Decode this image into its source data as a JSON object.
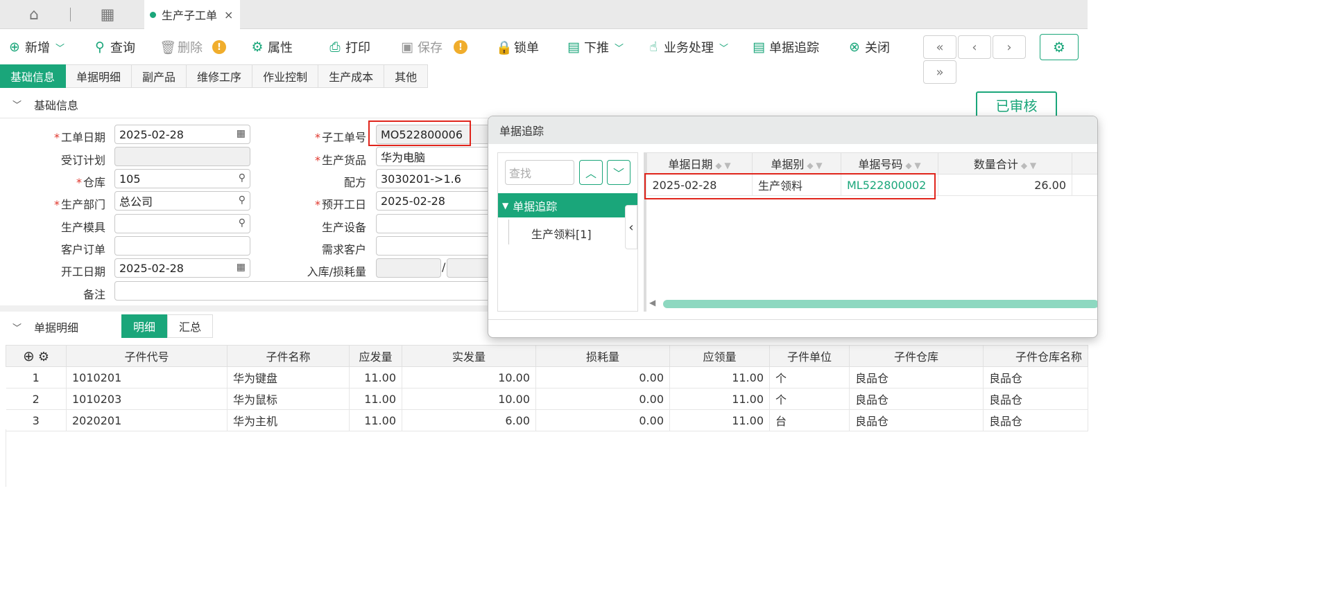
{
  "tabbar": {
    "doc_tab": "生产子工单",
    "close": "×"
  },
  "toolbar": {
    "add": "新增",
    "query": "查询",
    "delete": "删除",
    "properties": "属性",
    "print": "打印",
    "save": "保存",
    "lock": "锁单",
    "push_down": "下推",
    "business": "业务处理",
    "trace": "单据追踪",
    "close": "关闭",
    "warn_mark": "!"
  },
  "nav": {
    "first": "«",
    "prev": "‹",
    "next": "›",
    "last": "»"
  },
  "subtabs": [
    "基础信息",
    "单据明细",
    "副产品",
    "维修工序",
    "作业控制",
    "生产成本",
    "其他"
  ],
  "sections": {
    "basic": "基础信息",
    "detail": "单据明细"
  },
  "status_badge": "已审核",
  "form": {
    "order_date": {
      "label": "工单日期",
      "value": "2025-02-28"
    },
    "sub_order_no": {
      "label": "子工单号",
      "value": "MO522800006"
    },
    "plan": {
      "label": "受订计划",
      "value": ""
    },
    "product": {
      "label": "生产货品",
      "value": "华为电脑"
    },
    "warehouse": {
      "label": "仓库",
      "value": "105"
    },
    "formula": {
      "label": "配方",
      "value": "3030201->1.6"
    },
    "dept": {
      "label": "生产部门",
      "value": "总公司"
    },
    "planned_start": {
      "label": "预开工日",
      "value": "2025-02-28"
    },
    "mold": {
      "label": "生产模具",
      "value": ""
    },
    "equipment": {
      "label": "生产设备",
      "value": ""
    },
    "customer_order": {
      "label": "客户订单",
      "value": ""
    },
    "demand_customer": {
      "label": "需求客户",
      "value": ""
    },
    "start_date": {
      "label": "开工日期",
      "value": "2025-02-28"
    },
    "in_loss": {
      "label": "入库/损耗量",
      "sep": "/"
    },
    "remark": {
      "label": "备注",
      "value": ""
    }
  },
  "detail_tabs": [
    "明细",
    "汇总"
  ],
  "detail_table": {
    "headers": [
      "子件代号",
      "子件名称",
      "应发量",
      "实发量",
      "损耗量",
      "应领量",
      "子件单位",
      "子件仓库",
      "子件仓库名称"
    ],
    "rows": [
      [
        "1",
        "1010201",
        "华为键盘",
        "11.00",
        "10.00",
        "0.00",
        "11.00",
        "个",
        "良品仓",
        "良品仓"
      ],
      [
        "2",
        "1010203",
        "华为鼠标",
        "11.00",
        "10.00",
        "0.00",
        "11.00",
        "个",
        "良品仓",
        "良品仓"
      ],
      [
        "3",
        "2020201",
        "华为主机",
        "11.00",
        "6.00",
        "0.00",
        "11.00",
        "台",
        "良品仓",
        "良品仓"
      ]
    ]
  },
  "dialog": {
    "title": "单据追踪",
    "search_placeholder": "查找",
    "tree_root": "单据追踪",
    "tree_child": "生产领料[1]",
    "headers": [
      "单据日期",
      "单据别",
      "单据号码",
      "数量合计"
    ],
    "row": {
      "date": "2025-02-28",
      "type": "生产领料",
      "number": "ML522800002",
      "qty": "26.00"
    }
  },
  "colors": {
    "accent": "#1aa67a",
    "highlight": "#e0241b",
    "required": "#e0352b"
  }
}
